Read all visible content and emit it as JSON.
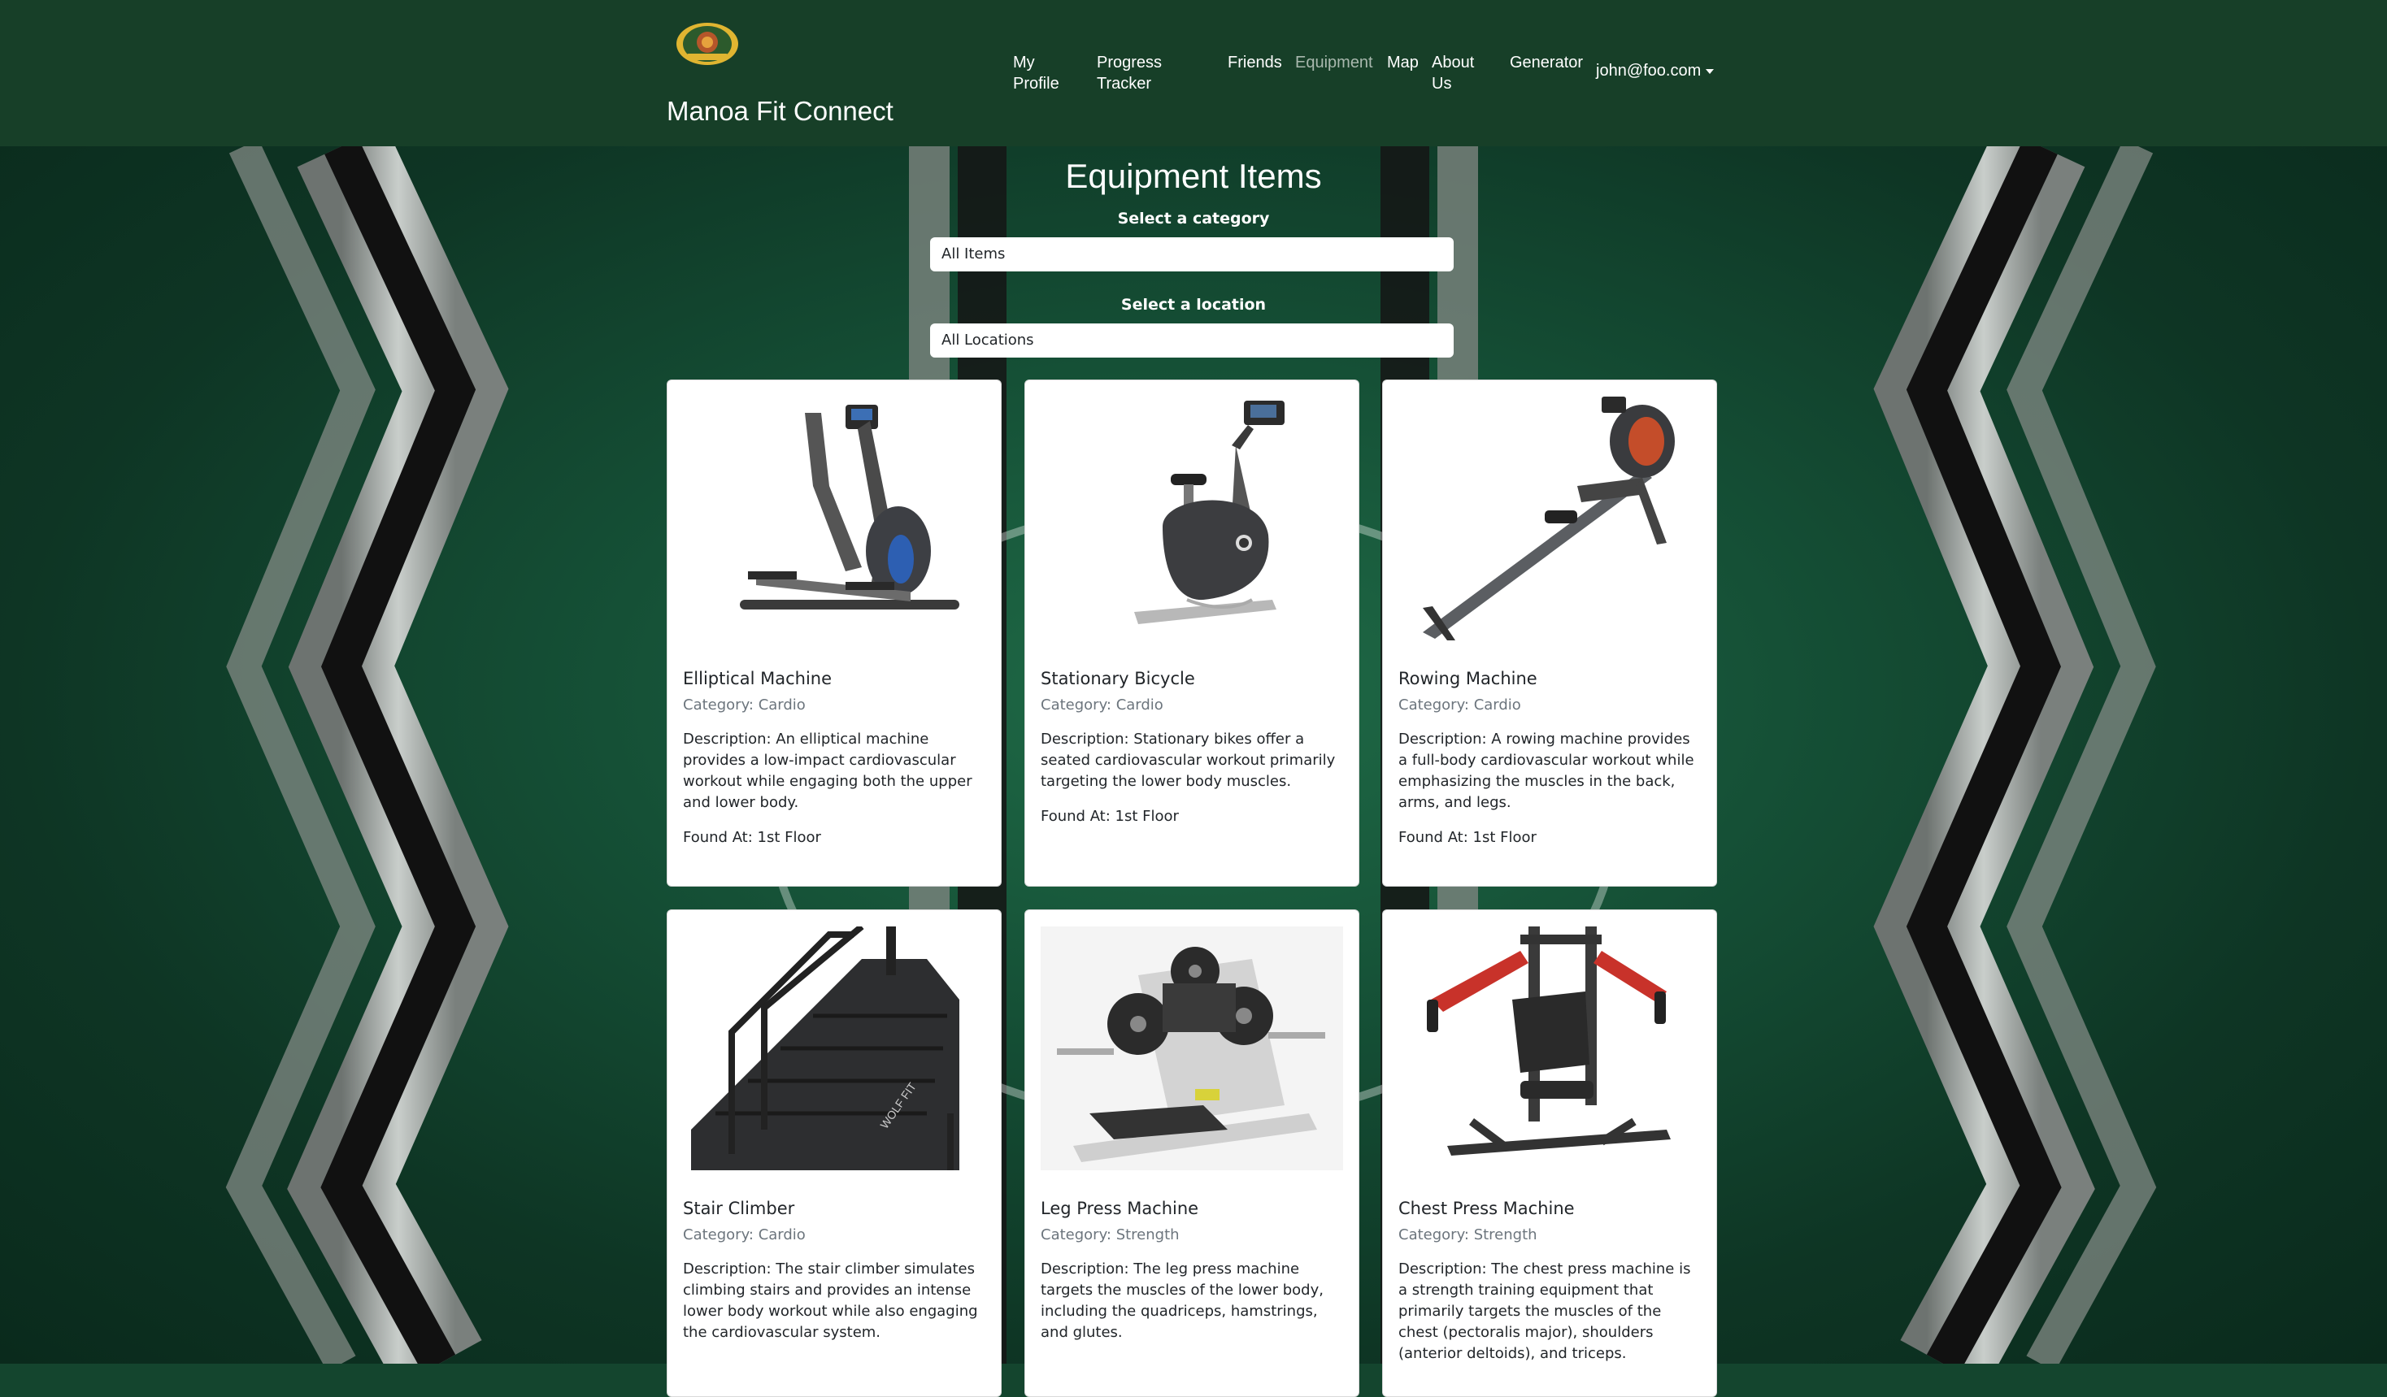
{
  "navbar": {
    "brand": "Manoa Fit Connect",
    "links": [
      {
        "label": "My Profile"
      },
      {
        "label": "Progress Tracker"
      },
      {
        "label": "Friends"
      },
      {
        "label": "Equipment"
      },
      {
        "label": "Map"
      },
      {
        "label": "About Us"
      },
      {
        "label": "Generator"
      }
    ],
    "user": "john@foo.com",
    "colors": {
      "background": "#173f28",
      "active_link": "#a9b8ae"
    }
  },
  "page": {
    "title": "Equipment Items",
    "category_label": "Select a category",
    "category_value": "All Items",
    "location_label": "Select a location",
    "location_value": "All Locations"
  },
  "cards": [
    {
      "title": "Elliptical Machine",
      "category": "Category: Cardio",
      "description": "Description: An elliptical machine provides a low-impact cardiovascular workout while engaging both the upper and lower body.",
      "found": "Found At: 1st Floor",
      "image": "elliptical-machine-image"
    },
    {
      "title": "Stationary Bicycle",
      "category": "Category: Cardio",
      "description": "Description: Stationary bikes offer a seated cardiovascular workout primarily targeting the lower body muscles.",
      "found": "Found At: 1st Floor",
      "image": "stationary-bicycle-image"
    },
    {
      "title": "Rowing Machine",
      "category": "Category: Cardio",
      "description": "Description: A rowing machine provides a full-body cardiovascular workout while emphasizing the muscles in the back, arms, and legs.",
      "found": "Found At: 1st Floor",
      "image": "rowing-machine-image"
    },
    {
      "title": "Stair Climber",
      "category": "Category: Cardio",
      "description": "Description: The stair climber simulates climbing stairs and provides an intense lower body workout while also engaging the cardiovascular system.",
      "image": "stair-climber-image"
    },
    {
      "title": "Leg Press Machine",
      "category": "Category: Strength",
      "description": "Description: The leg press machine targets the muscles of the lower body, including the quadriceps, hamstrings, and glutes.",
      "image": "leg-press-machine-image"
    },
    {
      "title": "Chest Press Machine",
      "category": "Category: Strength",
      "description": "Description: The chest press machine is a strength training equipment that primarily targets the muscles of the chest (pectoralis major), shoulders (anterior deltoids), and triceps.",
      "image": "chest-press-machine-image"
    }
  ]
}
